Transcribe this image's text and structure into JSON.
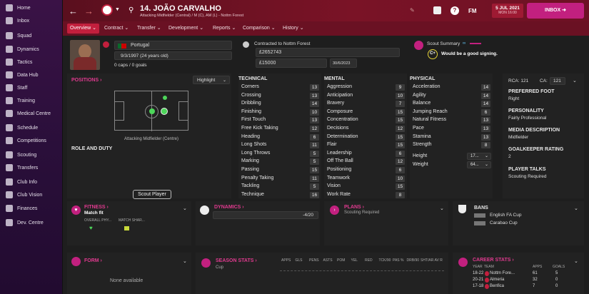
{
  "nav": [
    "Home",
    "Inbox",
    "Squad",
    "Dynamics",
    "Tactics",
    "Data Hub",
    "Staff",
    "Training",
    "Medical Centre",
    "Schedule",
    "Competitions",
    "Scouting",
    "Transfers",
    "Club Info",
    "Club Vision",
    "Finances",
    "Dev. Centre"
  ],
  "header": {
    "title": "14. JOÃO CARVALHO",
    "subtitle": "Attacking Midfielder (Central) / M (C), AM (L) - Nottm Forest",
    "date_line1": "5 JUL 2021",
    "date_line2": "MON 16:00",
    "fm": "FM",
    "inbox": "INBOX"
  },
  "tabs": [
    {
      "label": "Overview"
    },
    {
      "label": "Contract"
    },
    {
      "label": "Transfer"
    },
    {
      "label": "Development"
    },
    {
      "label": "Reports"
    },
    {
      "label": "Comparison"
    },
    {
      "label": "History"
    }
  ],
  "profile": {
    "nation": "Portugal",
    "dob": "9/3/1997 (24 years old)",
    "caps": "0 caps / 0 goals",
    "contract": "Contracted to Nottm Forest",
    "value": "£2652743",
    "wage": "£15000",
    "expiry": "30/6/2023",
    "scout_title": "Scout Summary",
    "scout_grade": "C+",
    "scout_text": "Would be a good signing."
  },
  "positions": {
    "title": "POSITIONS",
    "highlight": "Highlight",
    "pos_label": "Attacking Midfielder (Centre)",
    "role_title": "ROLE AND DUTY",
    "scout_button": "Scout Player"
  },
  "technical": {
    "title": "TECHNICAL",
    "attrs": [
      [
        "Corners",
        "13"
      ],
      [
        "Crossing",
        "13"
      ],
      [
        "Dribbling",
        "14"
      ],
      [
        "Finishing",
        "10"
      ],
      [
        "First Touch",
        "13"
      ],
      [
        "Free Kick Taking",
        "12"
      ],
      [
        "Heading",
        "6"
      ],
      [
        "Long Shots",
        "11"
      ],
      [
        "Long Throws",
        "5"
      ],
      [
        "Marking",
        "5"
      ],
      [
        "Passing",
        "15"
      ],
      [
        "Penalty Taking",
        "11"
      ],
      [
        "Tackling",
        "5"
      ],
      [
        "Technique",
        "16"
      ]
    ]
  },
  "mental": {
    "title": "MENTAL",
    "attrs": [
      [
        "Aggression",
        "9"
      ],
      [
        "Anticipation",
        "10"
      ],
      [
        "Bravery",
        "7"
      ],
      [
        "Composure",
        "15"
      ],
      [
        "Concentration",
        "15"
      ],
      [
        "Decisions",
        "12"
      ],
      [
        "Determination",
        "15"
      ],
      [
        "Flair",
        "15"
      ],
      [
        "Leadership",
        "6"
      ],
      [
        "Off The Ball",
        "12"
      ],
      [
        "Positioning",
        "6"
      ],
      [
        "Teamwork",
        "10"
      ],
      [
        "Vision",
        "15"
      ],
      [
        "Work Rate",
        "8"
      ]
    ]
  },
  "physical": {
    "title": "PHYSICAL",
    "attrs": [
      [
        "Acceleration",
        "14"
      ],
      [
        "Agility",
        "14"
      ],
      [
        "Balance",
        "14"
      ],
      [
        "Jumping Reach",
        "6"
      ],
      [
        "Natural Fitness",
        "13"
      ],
      [
        "Pace",
        "13"
      ],
      [
        "Stamina",
        "13"
      ],
      [
        "Strength",
        "8"
      ]
    ],
    "height_label": "Height",
    "height_val": "17...",
    "weight_label": "Weight",
    "weight_val": "64..."
  },
  "side": {
    "rca": "RCA: 121",
    "ca_label": "CA:",
    "ca_val": "121",
    "pref_foot_t": "PREFERRED FOOT",
    "pref_foot": "Right",
    "personality_t": "PERSONALITY",
    "personality": "Fairly Professional",
    "media_t": "MEDIA DESCRIPTION",
    "media": "Midfielder",
    "gk_t": "GOALKEEPER RATING",
    "gk": "2",
    "talks_t": "PLAYER TALKS",
    "talks": "Scouting Required"
  },
  "fitness": {
    "title": "FITNESS",
    "sub": "Match fit",
    "c1": "OVERALL PHY...",
    "c2": "MATCH SHAR..."
  },
  "dynamics": {
    "title": "DYNAMICS",
    "val": "-4/20"
  },
  "plans": {
    "title": "PLANS",
    "sub": "Scouting Required"
  },
  "bans": {
    "title": "BANS",
    "items": [
      "English FA Cup",
      "Carabao Cup"
    ]
  },
  "form": {
    "title": "FORM",
    "none": "None available"
  },
  "season": {
    "title": "SEASON STATS",
    "sub": "Cup",
    "cols": [
      "APPS",
      "GLS",
      "PENS",
      "ASTS",
      "POM",
      "YEL",
      "RED",
      "TCK/90",
      "PAS %",
      "DRB/90",
      "SHT/AR",
      "AV R"
    ]
  },
  "career": {
    "title": "CAREER STATS",
    "cols": [
      "YEAR",
      "TEAM",
      "APPS",
      "GOALS"
    ],
    "rows": [
      [
        "18-22",
        "Nottm Fore...",
        "61",
        "5"
      ],
      [
        "20-21",
        "Almeria",
        "32",
        "0"
      ],
      [
        "17-18",
        "Benfica",
        "7",
        "0"
      ]
    ]
  }
}
